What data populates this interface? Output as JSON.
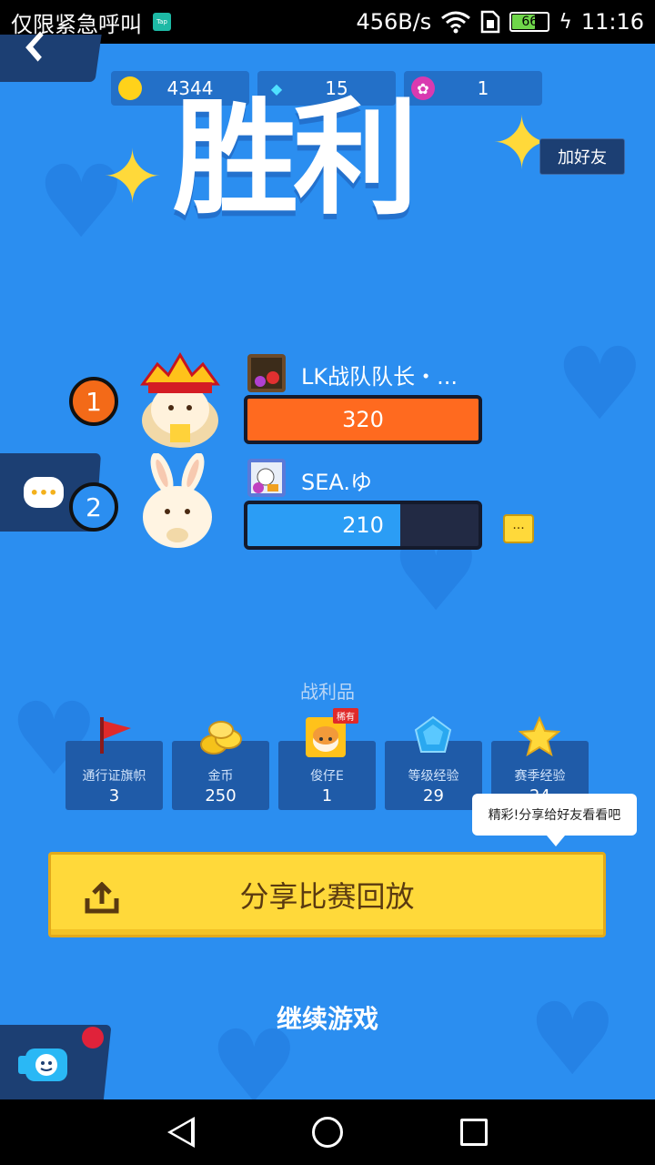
{
  "status_bar": {
    "carrier_text": "仅限紧急呼叫",
    "app_icon": "Tap",
    "network_speed": "456B/s",
    "battery_level": "66",
    "battery_percent": 66,
    "time": "11:16"
  },
  "currencies": [
    {
      "icon": "gold-coin-icon",
      "value": "4344"
    },
    {
      "icon": "diamond-icon",
      "value": "15"
    },
    {
      "icon": "lotus-icon",
      "value": "1"
    }
  ],
  "result_title": "胜利",
  "add_friend_label": "加好友",
  "players": [
    {
      "rank": "1",
      "name": "LK战队队长・...",
      "score": "320",
      "score_fraction": 1.0,
      "bar_color": "#ff6a1f",
      "rank_color": "#f36a18"
    },
    {
      "rank": "2",
      "name": "SEA.ゆ",
      "score": "210",
      "score_fraction": 0.66,
      "bar_color": "#2b9df5",
      "rank_color": "#2b8ef0"
    }
  ],
  "more_label": "···",
  "chat_label": "•••",
  "loot_title": "战利品",
  "loot": [
    {
      "label": "通行证旗帜",
      "value": "3",
      "icon": "red-flag-icon"
    },
    {
      "label": "金币",
      "value": "250",
      "icon": "coins-icon"
    },
    {
      "label": "俊仔E",
      "value": "1",
      "icon": "dog-character-icon",
      "badge": "稀有"
    },
    {
      "label": "等级经验",
      "value": "29",
      "icon": "blue-gem-icon"
    },
    {
      "label": "赛季经验",
      "value": "24",
      "icon": "star-icon"
    }
  ],
  "tooltip": "精彩!分享给好友看看吧",
  "share_button_label": "分享比赛回放",
  "continue_label": "继续游戏",
  "colors": {
    "background": "#2b8ef0",
    "panel": "#1c3f73",
    "accent_yellow": "#ffd93a"
  }
}
